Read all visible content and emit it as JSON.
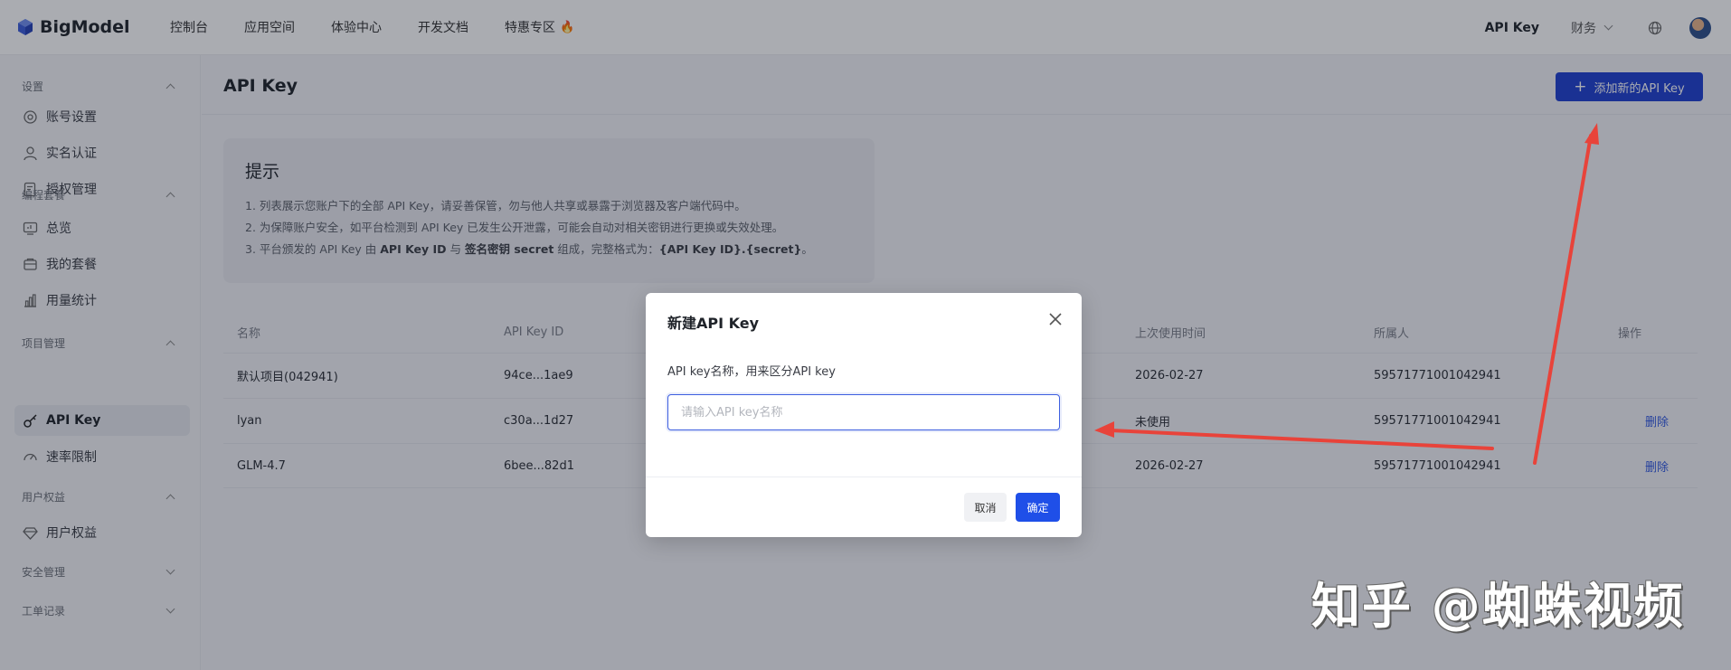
{
  "brand": {
    "name": "BigModel",
    "accent": "#1f3fd1"
  },
  "nav": {
    "items": [
      {
        "label": "控制台"
      },
      {
        "label": "应用空间"
      },
      {
        "label": "体验中心"
      },
      {
        "label": "开发文档"
      },
      {
        "label": "特惠专区",
        "icon": "fire-icon"
      }
    ],
    "api_key": "API Key",
    "finance": "财务"
  },
  "sidebar": {
    "group_settings": "设置",
    "account_settings": "账号设置",
    "real_name": "实名认证",
    "auth_manage": "授权管理",
    "group_coding": "编程套餐",
    "overview": "总览",
    "my_plan": "我的套餐",
    "usage_stats": "用量统计",
    "group_project": "项目管理",
    "api_key": "API Key",
    "rate_limit": "速率限制",
    "group_rights": "用户权益",
    "user_rights": "用户权益",
    "group_security": "安全管理",
    "group_ticket": "工单记录"
  },
  "page": {
    "title": "API Key",
    "add_button": "添加新的API Key"
  },
  "tip": {
    "title": "提示",
    "line1": "1. 列表展示您账户下的全部 API Key，请妥善保管，勿与他人共享或暴露于浏览器及客户端代码中。",
    "line2": "2. 为保障账户安全，如平台检测到 API Key 已发生公开泄露，可能会自动对相关密钥进行更换或失效处理。",
    "line3_a": "3. 平台颁发的 API Key 由 ",
    "line3_b": "API Key ID",
    "line3_c": " 与 ",
    "line3_d": "签名密钥 secret",
    "line3_e": " 组成，完整格式为：",
    "line3_f": "{API Key ID}.{secret}",
    "line3_g": "。"
  },
  "table": {
    "headers": {
      "name": "名称",
      "id": "API Key ID",
      "last_used": "上次使用时间",
      "owner": "所属人",
      "action": "操作"
    },
    "rows": [
      {
        "name": "默认项目(042941)",
        "id": "94ce...1ae9",
        "last_used": "2026-02-27",
        "owner": "59571771001042941",
        "action": ""
      },
      {
        "name": "lyan",
        "id": "c30a...1d27",
        "last_used": "未使用",
        "owner": "59571771001042941",
        "action": "删除"
      },
      {
        "name": "GLM-4.7",
        "id": "6bee...82d1",
        "last_used": "2026-02-27",
        "owner": "59571771001042941",
        "action": "删除"
      }
    ]
  },
  "modal": {
    "title": "新建API Key",
    "label": "API key名称，用来区分API key",
    "input_value": "",
    "input_placeholder": "请输入API key名称",
    "cancel": "取消",
    "confirm": "确定"
  },
  "watermark": "知乎 @蜘蛛视频",
  "annotation_color": "#e8433a"
}
